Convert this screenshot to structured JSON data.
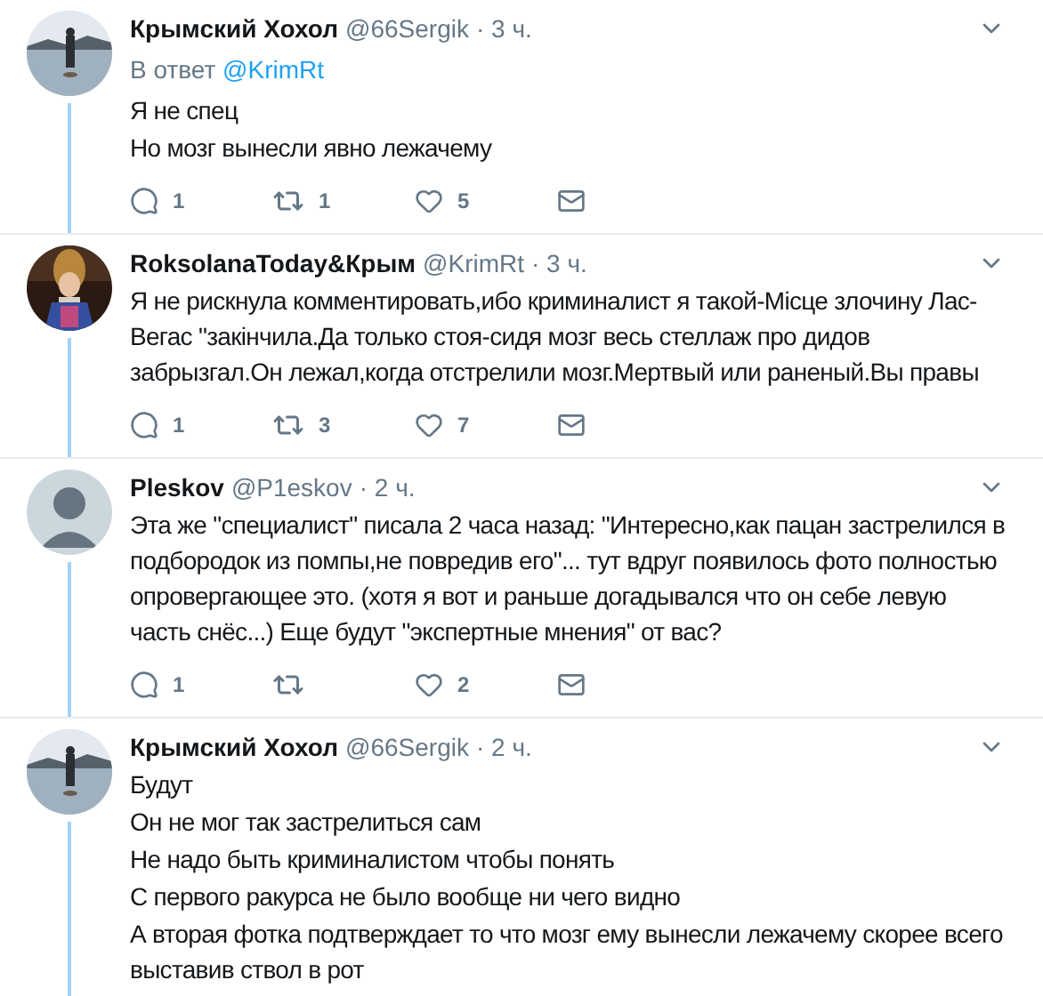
{
  "tweets": [
    {
      "avatar": {
        "kind": "picture"
      },
      "name": "Крымский Хохол",
      "handle": "@66Sergik",
      "time": "· 3 ч.",
      "reply_prefix": "В ответ",
      "reply_to": "@KrimRt",
      "lines": [
        "Я не спец",
        "Но мозг вынесли явно лежачему"
      ],
      "replies": "1",
      "retweets": "1",
      "likes": "5",
      "thread_line": true
    },
    {
      "avatar": {
        "kind": "picture"
      },
      "name": "RoksolanaToday&Крым",
      "handle": "@KrimRt",
      "time": "· 3 ч.",
      "lines": [
        "Я не рискнула комментировать,ибо криминалист я такой-Місце злочину Лас-Вегас \"закінчила.Да только стоя-сидя мозг весь стеллаж про дидов забрызгал.Он лежал,когда отстрелили мозг.Мертвый или раненый.Вы правы"
      ],
      "replies": "1",
      "retweets": "3",
      "likes": "7",
      "thread_line": true
    },
    {
      "avatar": {
        "kind": "default"
      },
      "name": "Pleskov",
      "handle": "@P1eskov",
      "time": "· 2 ч.",
      "lines": [
        "Эта же \"специалист\" писала 2 часа назад: \"Интересно,как пацан застрелился в подбородок из помпы,не повредив его\"... тут вдруг появилось фото полностью опровергающее это. (хотя я вот и раньше догадывался что он себе левую часть снёс...) Еще будут \"экспертные мнения\" от вас?"
      ],
      "replies": "1",
      "likes": "2",
      "thread_line": true
    },
    {
      "avatar": {
        "kind": "picture"
      },
      "name": "Крымский Хохол",
      "handle": "@66Sergik",
      "time": "· 2 ч.",
      "lines": [
        "Будут",
        "Он не мог так застрелиться сам",
        "Не надо быть криминалистом чтобы понять",
        "С первого ракурса не было вообще ни чего видно",
        "А вторая фотка подтверждает то что мозг ему вынесли лежачему скорее всего выставив ствол в рот"
      ],
      "thread_line": true
    }
  ]
}
